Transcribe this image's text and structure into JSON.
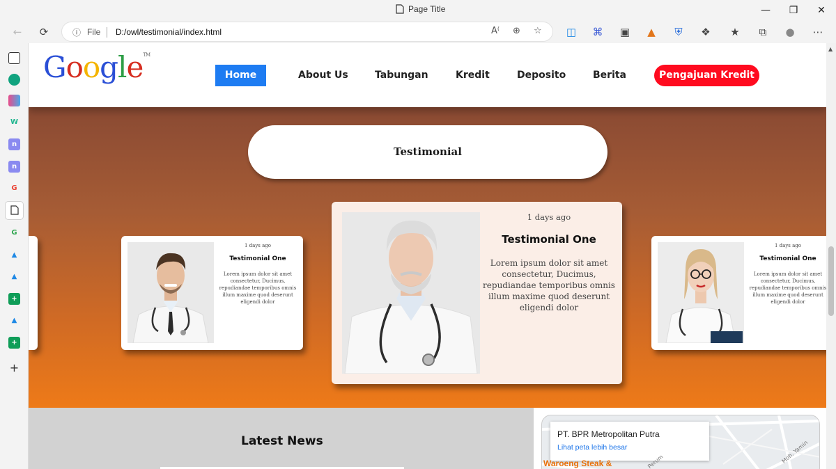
{
  "browser": {
    "title": "Page Title",
    "scheme": "File",
    "url": "D:/owl/testimonial/index.html"
  },
  "nav": {
    "logo": "Google",
    "logo_tm": "TM",
    "items": [
      "Home",
      "About Us",
      "Tabungan",
      "Kredit",
      "Deposito",
      "Berita"
    ],
    "cta": "Pengajuan Kredit"
  },
  "testimonial": {
    "heading": "Testimonial",
    "cards": [
      {
        "date": "1 days ago",
        "name": "Testimonial One",
        "body": "Lorem ipsum dolor sit amet consectetur, Ducimus, repudiandae temporibus omnis illum maxime quod deserunt eligendi dolor"
      },
      {
        "date": "1 days ago",
        "name": "Testimonial One",
        "body": "Lorem ipsum dolor sit amet consectetur, Ducimus, repudiandae temporibus omnis illum maxime quod deserunt eligendi dolor"
      },
      {
        "date": "1 days ago",
        "name": "Testimonial One",
        "body": "Lorem ipsum dolor sit amet consectetur, Ducimus, repudiandae temporibus omnis illum maxime quod deserunt eligendi dolor"
      }
    ]
  },
  "news": {
    "heading": "Latest News"
  },
  "map": {
    "place": "PT. BPR Metropolitan Putra",
    "link": "Lihat peta lebih besar",
    "poi": "Waroeng Steak &",
    "road_1": "Moh. Yamin",
    "road_2": "Perum"
  },
  "colors": {
    "accent": "#1e7cf2",
    "cta": "#ff0b1f",
    "hero_top": "#8a4a33",
    "hero_bottom": "#ee7a18"
  }
}
